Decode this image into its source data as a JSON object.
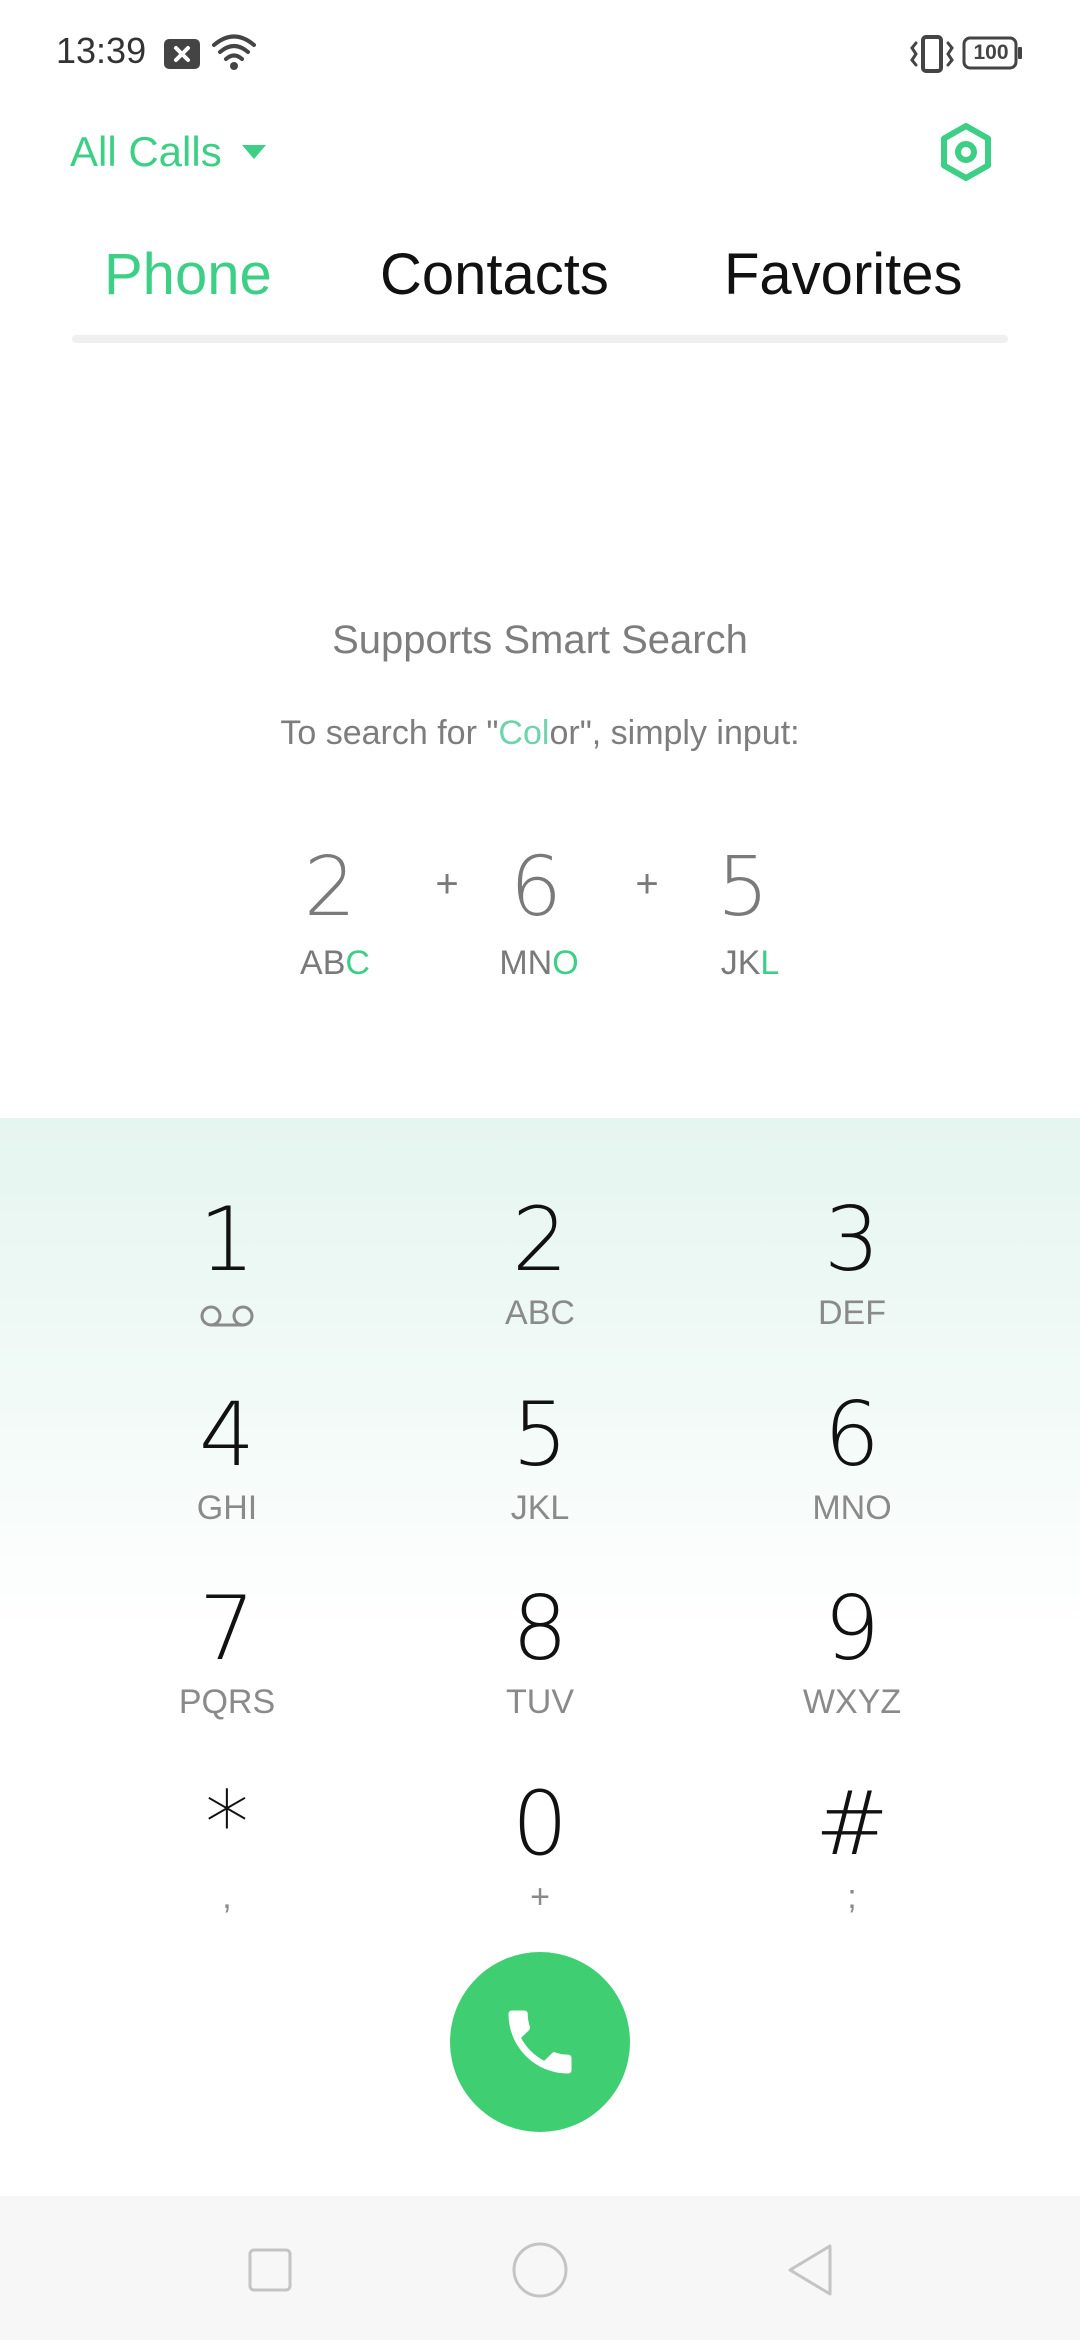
{
  "status_bar": {
    "time": "13:39",
    "battery": "100",
    "icons": [
      "notification-icon",
      "wifi-icon",
      "vibrate-icon",
      "battery-icon"
    ]
  },
  "header": {
    "filter_label": "All Calls",
    "settings_icon": "settings-icon"
  },
  "tabs": [
    {
      "label": "Phone",
      "active": true
    },
    {
      "label": "Contacts",
      "active": false
    },
    {
      "label": "Favorites",
      "active": false
    }
  ],
  "hint": {
    "title": "Supports Smart Search",
    "subtitle_prefix": "To search for \"",
    "subtitle_highlight": "Col",
    "subtitle_mid": "or",
    "subtitle_suffix": "\", simply input:",
    "example": [
      {
        "digit": "2",
        "letters": "AB",
        "highlight": "C"
      },
      {
        "digit": "6",
        "letters": "MN",
        "highlight": "O"
      },
      {
        "digit": "5",
        "letters": "JK",
        "highlight": "L"
      }
    ],
    "plus": "+"
  },
  "keypad": {
    "keys": [
      {
        "digit": "1",
        "sub": ""
      },
      {
        "digit": "2",
        "sub": "ABC"
      },
      {
        "digit": "3",
        "sub": "DEF"
      },
      {
        "digit": "4",
        "sub": "GHI"
      },
      {
        "digit": "5",
        "sub": "JKL"
      },
      {
        "digit": "6",
        "sub": "MNO"
      },
      {
        "digit": "7",
        "sub": "PQRS"
      },
      {
        "digit": "8",
        "sub": "TUV"
      },
      {
        "digit": "9",
        "sub": "WXYZ"
      },
      {
        "digit": "*",
        "sub": ","
      },
      {
        "digit": "0",
        "sub": "+"
      },
      {
        "digit": "#",
        "sub": ";"
      }
    ]
  },
  "colors": {
    "accent": "#3ccf85",
    "call_button": "#3fcf72"
  }
}
